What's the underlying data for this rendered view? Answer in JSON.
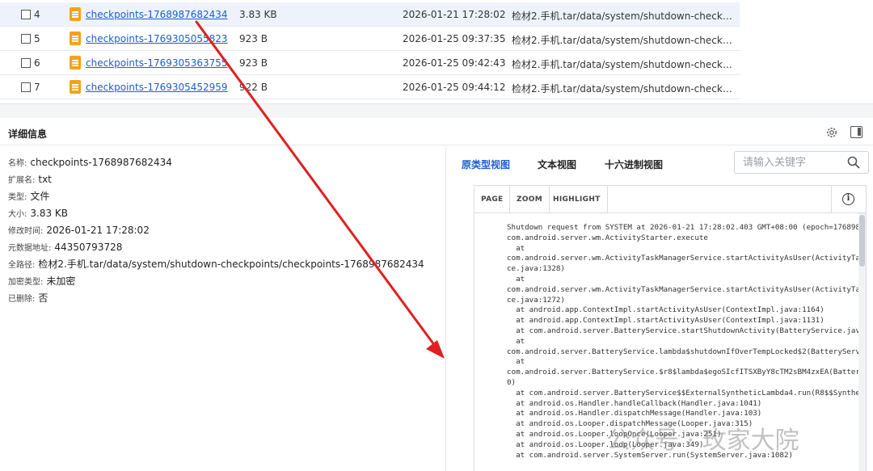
{
  "file_table": {
    "rows": [
      {
        "index": "4",
        "name": "checkpoints-1768987682434",
        "size": "3.83 KB",
        "time": "2026-01-21 17:28:02",
        "path": "检材2.手机.tar/data/system/shutdown-checkpoints...",
        "selected": true
      },
      {
        "index": "5",
        "name": "checkpoints-1769305055823",
        "size": "923 B",
        "time": "2026-01-25 09:37:35",
        "path": "检材2.手机.tar/data/system/shutdown-checkpoints...",
        "selected": false
      },
      {
        "index": "6",
        "name": "checkpoints-1769305363755",
        "size": "923 B",
        "time": "2026-01-25 09:42:43",
        "path": "检材2.手机.tar/data/system/shutdown-checkpoints...",
        "selected": false
      },
      {
        "index": "7",
        "name": "checkpoints-1769305452959",
        "size": "922 B",
        "time": "2026-01-25 09:44:12",
        "path": "检材2.手机.tar/data/system/shutdown-checkpoints...",
        "selected": false
      }
    ]
  },
  "details": {
    "title": "详细信息",
    "props": [
      {
        "key": "名称:",
        "value": "checkpoints-1768987682434"
      },
      {
        "key": "扩展名:",
        "value": "txt"
      },
      {
        "key": "类型:",
        "value": "文件"
      },
      {
        "key": "大小:",
        "value": "3.83 KB"
      },
      {
        "key": "修改时间:",
        "value": "2026-01-21 17:28:02"
      },
      {
        "key": "元数据地址:",
        "value": "44350793728"
      },
      {
        "key": "全路径:",
        "value": "检材2.手机.tar/data/system/shutdown-checkpoints/checkpoints-1768987682434"
      },
      {
        "key": "加密类型:",
        "value": "未加密"
      },
      {
        "key": "已删除:",
        "value": "否"
      }
    ]
  },
  "viewer": {
    "tabs": [
      "原类型视图",
      "文本视图",
      "十六进制视图"
    ],
    "active_tab": "原类型视图",
    "search_placeholder": "请输入关键字",
    "toolbar": {
      "page": "PAGE",
      "zoom": "ZOOM",
      "highlight": "HIGHLIGHT"
    },
    "content": "Shutdown request from SYSTEM at 2026-01-21 17:28:02.403 GMT+08:00 (epoch=1768987\ncom.android.server.wm.ActivityStarter.execute\n  at\ncom.android.server.wm.ActivityTaskManagerService.startActivityAsUser(ActivityTas\nce.java:1328)\n  at\ncom.android.server.wm.ActivityTaskManagerService.startActivityAsUser(ActivityTas\nce.java:1272)\n  at android.app.ContextImpl.startActivityAsUser(ContextImpl.java:1164)\n  at android.app.ContextImpl.startActivityAsUser(ContextImpl.java:1131)\n  at com.android.server.BatteryService.startShutdownActivity(BatteryService.java\n  at\ncom.android.server.BatteryService.lambda$shutdownIfOverTempLocked$2(BatteryServi\n  at\ncom.android.server.BatteryService.$r8$lambda$egoSIcfITSXByY8cTM2sBM4zxEA(Battery\n0)\n  at com.android.server.BatteryService$$ExternalSyntheticLambda4.run(R8$$Synthet\n  at android.os.Handler.handleCallback(Handler.java:1041)\n  at android.os.Handler.dispatchMessage(Handler.java:103)\n  at android.os.Looper.dispatchMessage(Looper.java:315)\n  at android.os.Looper.loopOnce(Looper.java:251)\n  at android.os.Looper.loop(Looper.java:349)\n  at com.android.server.SystemServer.run(SystemServer.java:1082)"
  },
  "watermark": "公众号 · 玫家大院",
  "colors": {
    "link": "#1a5fd1",
    "arrow": "#e02020",
    "file_icon": "#f4a21d"
  }
}
